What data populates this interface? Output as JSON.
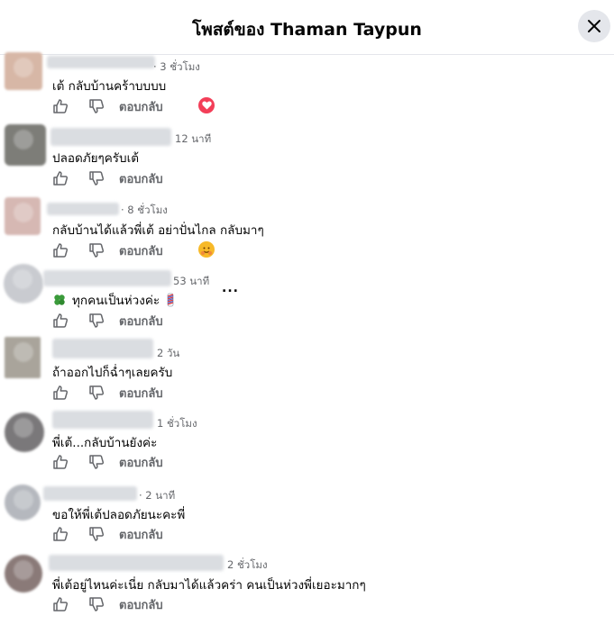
{
  "header": {
    "title": "โพสต์ของ Thaman Taypun"
  },
  "colors": {
    "header_border": "#e4e6eb",
    "secondary_text": "#65676b",
    "close_bg": "#e4e6eb",
    "love": "#f33e58",
    "icons": "#65676b"
  },
  "reply_label": "ตอบกลับ",
  "comments": [
    {
      "time": "· 3 ชั่วโมง",
      "text": "เต้ กลับบ้านคร้าบบบบ",
      "reaction": "heart-icon"
    },
    {
      "time": "12 นาที",
      "text": "ปลอดภัยๆครับเต้"
    },
    {
      "time": "· 8 ชั่วโมง",
      "text": "กลับบ้านได้แล้วพี่เต้ อย่าปั่นไกล กลับมาๆ",
      "reaction": "hug-emoji"
    },
    {
      "time": "53 นาที",
      "text_prefix_icon": "clover",
      "text": "ทุกคนเป็นห่วงค่ะ",
      "text_suffix_icon": "barber-pole",
      "more": "..."
    },
    {
      "time": "2 วัน",
      "text": "ถ้าออกไปก็ฉ่ำๆเลยครับ"
    },
    {
      "time": "1 ชั่วโมง",
      "text": "พี่เต้...กลับบ้านยังค่ะ"
    },
    {
      "time": "· 2 นาที",
      "text": "ขอให้พี่เต้ปลอดภัยนะคะพี่"
    },
    {
      "time": "2 ชั่วโมง",
      "text": "พี่เต้อยู่ไหนค่ะเนี่ย กลับมาได้แล้วคร่า คนเป็นห่วงพี่เยอะมากๆ"
    }
  ]
}
